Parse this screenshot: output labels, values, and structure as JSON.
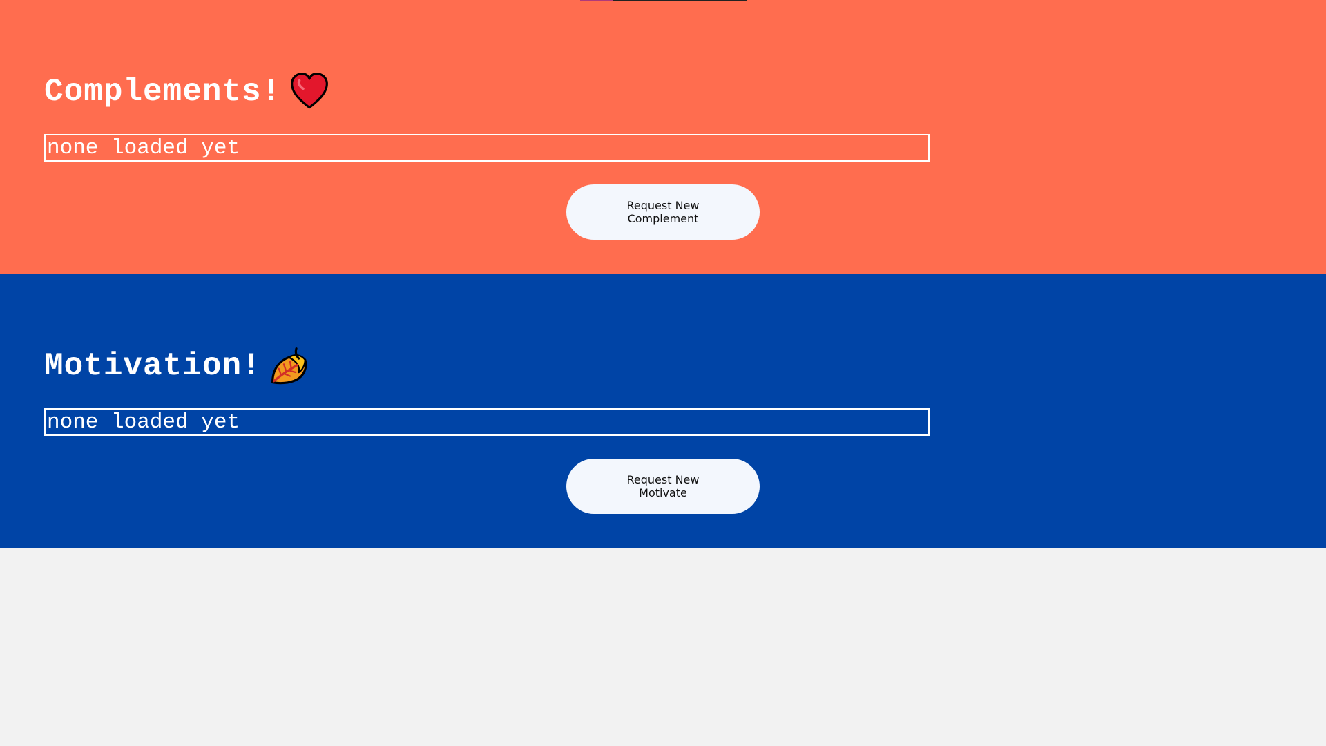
{
  "colors": {
    "complements_bg": "#ff6d4f",
    "motivation_bg": "#0044a6",
    "page_bg": "#f2f2f2",
    "button_bg": "#f3f7fd"
  },
  "complements": {
    "title": "Complements!",
    "icon": "red-heart-icon",
    "input_placeholder": "none loaded yet",
    "input_value": "",
    "button_label": "Request New Complement"
  },
  "motivation": {
    "title": "Motivation!",
    "icon": "fallen-leaf-icon",
    "input_placeholder": "none loaded yet",
    "input_value": "",
    "button_label": "Request New Motivate"
  }
}
